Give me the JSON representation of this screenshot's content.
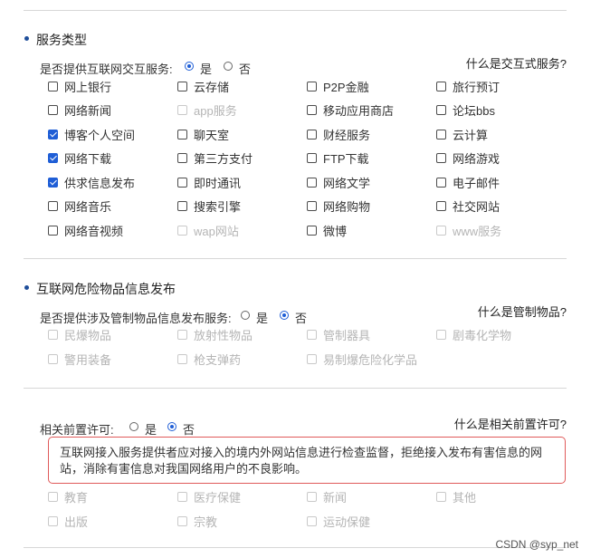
{
  "section1": {
    "title": "服务类型",
    "question": "是否提供互联网交互服务:",
    "yes": "是",
    "no": "否",
    "help": "什么是交互式服务?",
    "items": [
      {
        "label": "网上银行",
        "checked": false,
        "disabled": false
      },
      {
        "label": "云存储",
        "checked": false,
        "disabled": false
      },
      {
        "label": "P2P金融",
        "checked": false,
        "disabled": false
      },
      {
        "label": "旅行预订",
        "checked": false,
        "disabled": false
      },
      {
        "label": "网络新闻",
        "checked": false,
        "disabled": false
      },
      {
        "label": "app服务",
        "checked": false,
        "disabled": true
      },
      {
        "label": "移动应用商店",
        "checked": false,
        "disabled": false
      },
      {
        "label": "论坛bbs",
        "checked": false,
        "disabled": false
      },
      {
        "label": "博客个人空间",
        "checked": true,
        "disabled": false
      },
      {
        "label": "聊天室",
        "checked": false,
        "disabled": false
      },
      {
        "label": "财经服务",
        "checked": false,
        "disabled": false
      },
      {
        "label": "云计算",
        "checked": false,
        "disabled": false
      },
      {
        "label": "网络下载",
        "checked": true,
        "disabled": false
      },
      {
        "label": "第三方支付",
        "checked": false,
        "disabled": false
      },
      {
        "label": "FTP下载",
        "checked": false,
        "disabled": false
      },
      {
        "label": "网络游戏",
        "checked": false,
        "disabled": false
      },
      {
        "label": "供求信息发布",
        "checked": true,
        "disabled": false
      },
      {
        "label": "即时通讯",
        "checked": false,
        "disabled": false
      },
      {
        "label": "网络文学",
        "checked": false,
        "disabled": false
      },
      {
        "label": "电子邮件",
        "checked": false,
        "disabled": false
      },
      {
        "label": "网络音乐",
        "checked": false,
        "disabled": false
      },
      {
        "label": "搜索引擎",
        "checked": false,
        "disabled": false
      },
      {
        "label": "网络购物",
        "checked": false,
        "disabled": false
      },
      {
        "label": "社交网站",
        "checked": false,
        "disabled": false
      },
      {
        "label": "网络音视频",
        "checked": false,
        "disabled": false
      },
      {
        "label": "wap网站",
        "checked": false,
        "disabled": true
      },
      {
        "label": "微博",
        "checked": false,
        "disabled": false
      },
      {
        "label": "www服务",
        "checked": false,
        "disabled": true
      }
    ]
  },
  "section2": {
    "title": "互联网危险物品信息发布",
    "question": "是否提供涉及管制物品信息发布服务:",
    "yes": "是",
    "no": "否",
    "help": "什么是管制物品?",
    "items": [
      {
        "label": "民爆物品",
        "checked": false,
        "disabled": true
      },
      {
        "label": "放射性物品",
        "checked": false,
        "disabled": true
      },
      {
        "label": "管制器具",
        "checked": false,
        "disabled": true
      },
      {
        "label": "剧毒化学物",
        "checked": false,
        "disabled": true
      },
      {
        "label": "警用装备",
        "checked": false,
        "disabled": true
      },
      {
        "label": "枪支弹药",
        "checked": false,
        "disabled": true
      },
      {
        "label": "易制爆危险化学品",
        "checked": false,
        "disabled": true
      }
    ]
  },
  "section3": {
    "question": "相关前置许可:",
    "yes": "是",
    "no": "否",
    "help": "什么是相关前置许可?",
    "notice": "互联网接入服务提供者应对接入的境内外网站信息进行检查监督，拒绝接入发布有害信息的网站，消除有害信息对我国网络用户的不良影响。",
    "items": [
      {
        "label": "教育",
        "checked": false,
        "disabled": true
      },
      {
        "label": "医疗保健",
        "checked": false,
        "disabled": true
      },
      {
        "label": "新闻",
        "checked": false,
        "disabled": true
      },
      {
        "label": "其他",
        "checked": false,
        "disabled": true
      },
      {
        "label": "出版",
        "checked": false,
        "disabled": true
      },
      {
        "label": "宗教",
        "checked": false,
        "disabled": true
      },
      {
        "label": "运动保健",
        "checked": false,
        "disabled": true
      }
    ]
  },
  "watermark": "CSDN @syp_net"
}
